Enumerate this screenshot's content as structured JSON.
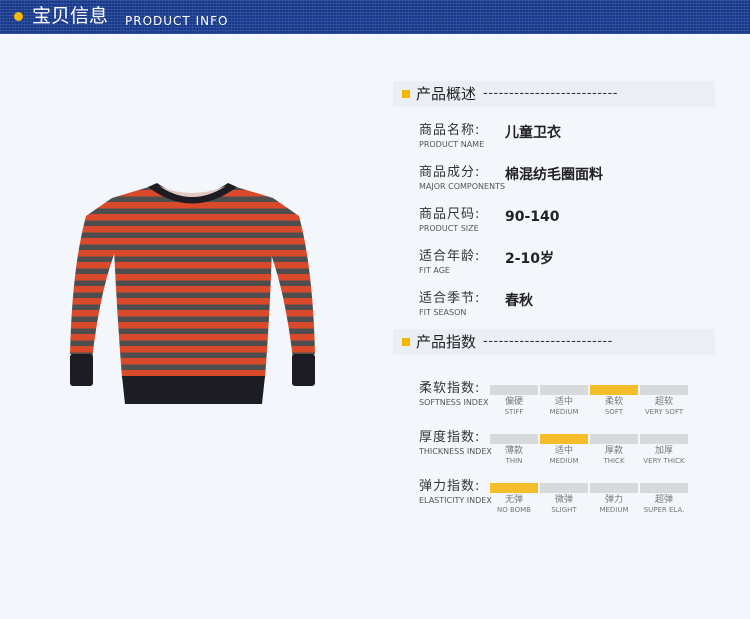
{
  "header": {
    "title": "宝贝信息",
    "subtitle": "PRODUCT INFO",
    "accent_color": "#f6b800",
    "background_color": "#17398c"
  },
  "product_image": {
    "icon": "striped-sweater-image",
    "stripe_colors": [
      "#d9492a",
      "#4e4e4e"
    ],
    "trim_color": "#1c1c22"
  },
  "overview": {
    "title": "产品概述",
    "dashes": "--------------------------",
    "rows": [
      {
        "label": "商品名称:",
        "label_en": "PRODUCT NAME",
        "value": "儿童卫衣"
      },
      {
        "label": "商品成分:",
        "label_en": "MAJOR COMPONENTS",
        "value": "棉混纺毛圈面料"
      },
      {
        "label": "商品尺码:",
        "label_en": "PRODUCT SIZE",
        "value": "90-140"
      },
      {
        "label": "适合年龄:",
        "label_en": "FIT AGE",
        "value": "2-10岁"
      },
      {
        "label": "适合季节:",
        "label_en": "FIT SEASON",
        "value": "春秋"
      }
    ]
  },
  "indices": {
    "title": "产品指数",
    "dashes": "-------------------------",
    "active_color": "#f6bd2b",
    "inactive_color": "#d7d9dd",
    "rows": [
      {
        "label": "柔软指数:",
        "label_en": "SOFTNESS INDEX",
        "selected": 2,
        "options": [
          {
            "cn": "偏硬",
            "en": "STIFF"
          },
          {
            "cn": "适中",
            "en": "MEDIUM"
          },
          {
            "cn": "柔软",
            "en": "SOFT"
          },
          {
            "cn": "超软",
            "en": "VERY SOFT"
          }
        ]
      },
      {
        "label": "厚度指数:",
        "label_en": "THICKNESS INDEX",
        "selected": 1,
        "options": [
          {
            "cn": "薄款",
            "en": "THIN"
          },
          {
            "cn": "适中",
            "en": "MEDIUM"
          },
          {
            "cn": "厚款",
            "en": "THICK"
          },
          {
            "cn": "加厚",
            "en": "VERY THICK"
          }
        ]
      },
      {
        "label": "弹力指数:",
        "label_en": "ELASTICITY INDEX",
        "selected": 0,
        "options": [
          {
            "cn": "无弹",
            "en": "NO BOMB"
          },
          {
            "cn": "微弹",
            "en": "SLIGHT"
          },
          {
            "cn": "弹力",
            "en": "MEDIUM"
          },
          {
            "cn": "超弹",
            "en": "SUPER ELA."
          }
        ]
      }
    ]
  }
}
